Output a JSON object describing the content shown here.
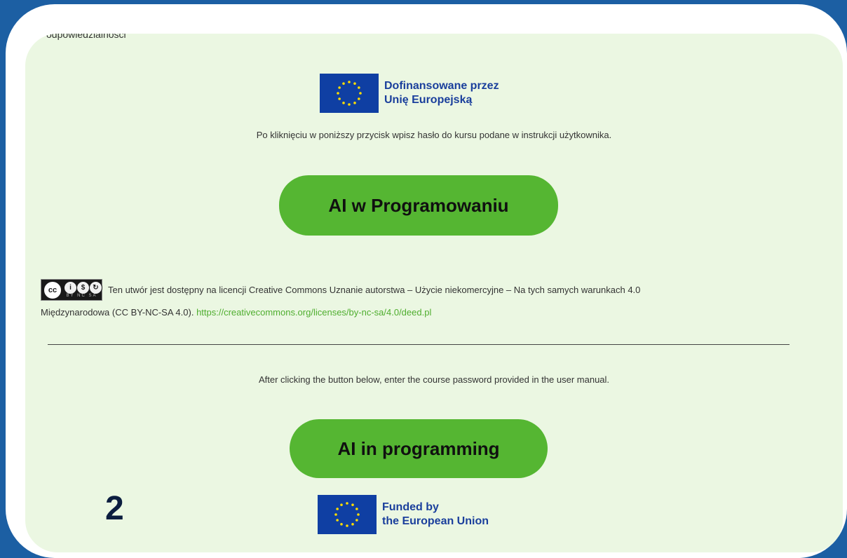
{
  "top_cut_text": "odpowiedzialności",
  "eu_logo_pl": {
    "line1": "Dofinansowane przez",
    "line2": "Unię Europejską"
  },
  "intro_pl": "Po kliknięciu w poniższy przycisk wpisz hasło do kursu podane w  instrukcji użytkownika.",
  "button_pl": "AI w Programowaniu",
  "license": {
    "badge_labels": [
      "cc",
      "BY",
      "NC",
      "SA"
    ],
    "text_line1": "Ten utwór jest dostępny na licencji Creative Commons Uznanie autorstwa – Użycie niekomercyjne – Na tych samych warunkach 4.0",
    "text_line2": "Międzynarodowa (CC BY-NC-SA 4.0).",
    "link": "https://creativecommons.org/licenses/by-nc-sa/4.0/deed.pl"
  },
  "intro_en": "After clicking the button below, enter the course password provided in the user manual.",
  "button_en": "AI in programming",
  "eu_logo_en": {
    "line1": "Funded by",
    "line2": "the European Union"
  },
  "page_number": "2",
  "colors": {
    "background_blue": "#1c5fa3",
    "panel_green": "#ebf7e2",
    "button_green": "#55b632",
    "eu_blue": "#0f3fa3",
    "eu_star": "#ffdd00",
    "link_green": "#4fae2f"
  }
}
